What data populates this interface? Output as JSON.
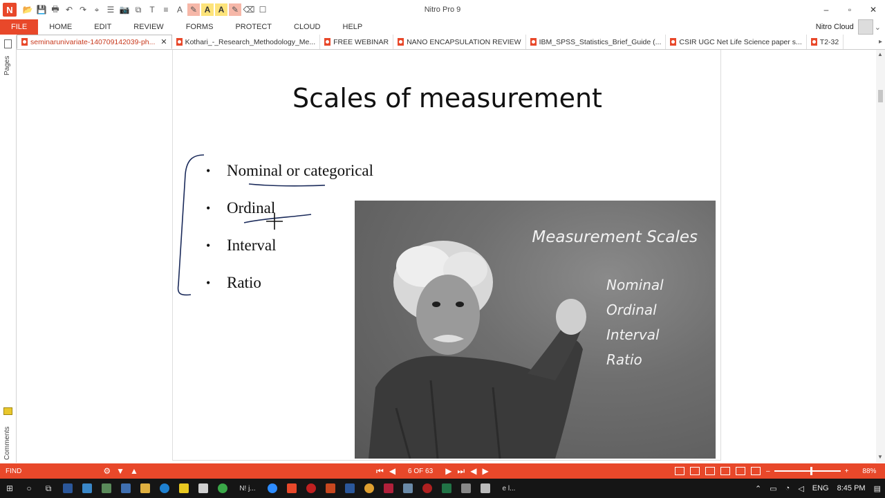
{
  "app": {
    "title": "Nitro Pro 9",
    "logo_letter": "N"
  },
  "window_controls": {
    "minimize": "–",
    "restore": "▫",
    "close": "✕"
  },
  "quick_access": [
    "📂",
    "💾",
    "🖶",
    "↶",
    "↷",
    "⌖",
    "☰",
    "📷",
    "⧉",
    "T",
    "≡",
    "A",
    "✎",
    "A",
    "A",
    "✎",
    "⌫",
    "☐"
  ],
  "ribbon": {
    "file": "FILE",
    "tabs": [
      "HOME",
      "EDIT",
      "REVIEW",
      "FORMS",
      "PROTECT",
      "CLOUD",
      "HELP"
    ],
    "cloud_user": "Nitro Cloud"
  },
  "doc_tabs": [
    {
      "label": "seminarunivariate-140709142039-ph...",
      "active": true
    },
    {
      "label": "Kothari_-_Research_Methodology_Me...",
      "active": false
    },
    {
      "label": "FREE WEBINAR",
      "active": false
    },
    {
      "label": "NANO ENCAPSULATION REVIEW",
      "active": false
    },
    {
      "label": "IBM_SPSS_Statistics_Brief_Guide (...",
      "active": false
    },
    {
      "label": "CSIR UGC Net Life Science paper s...",
      "active": false
    },
    {
      "label": "T2-32",
      "active": false
    }
  ],
  "left_pane": {
    "pages_label": "Pages",
    "comments_label": "Comments"
  },
  "slide": {
    "title": "Scales of measurement",
    "bullets": [
      "Nominal or categorical",
      "Ordinal",
      "Interval",
      "Ratio"
    ],
    "board": {
      "title": "Measurement Scales",
      "items": [
        "Nominal",
        "Ordinal",
        "Interval",
        "Ratio"
      ]
    }
  },
  "statusbar": {
    "find": "FIND",
    "page_indicator": "6 OF 63",
    "zoom": "88%",
    "zoom_minus": "–",
    "zoom_plus": "+",
    "zoom_level": 0.55
  },
  "taskbar": {
    "apps": [
      "Nǃ j...",
      "e l..."
    ],
    "language": "ENG",
    "time": "8:45 PM"
  }
}
